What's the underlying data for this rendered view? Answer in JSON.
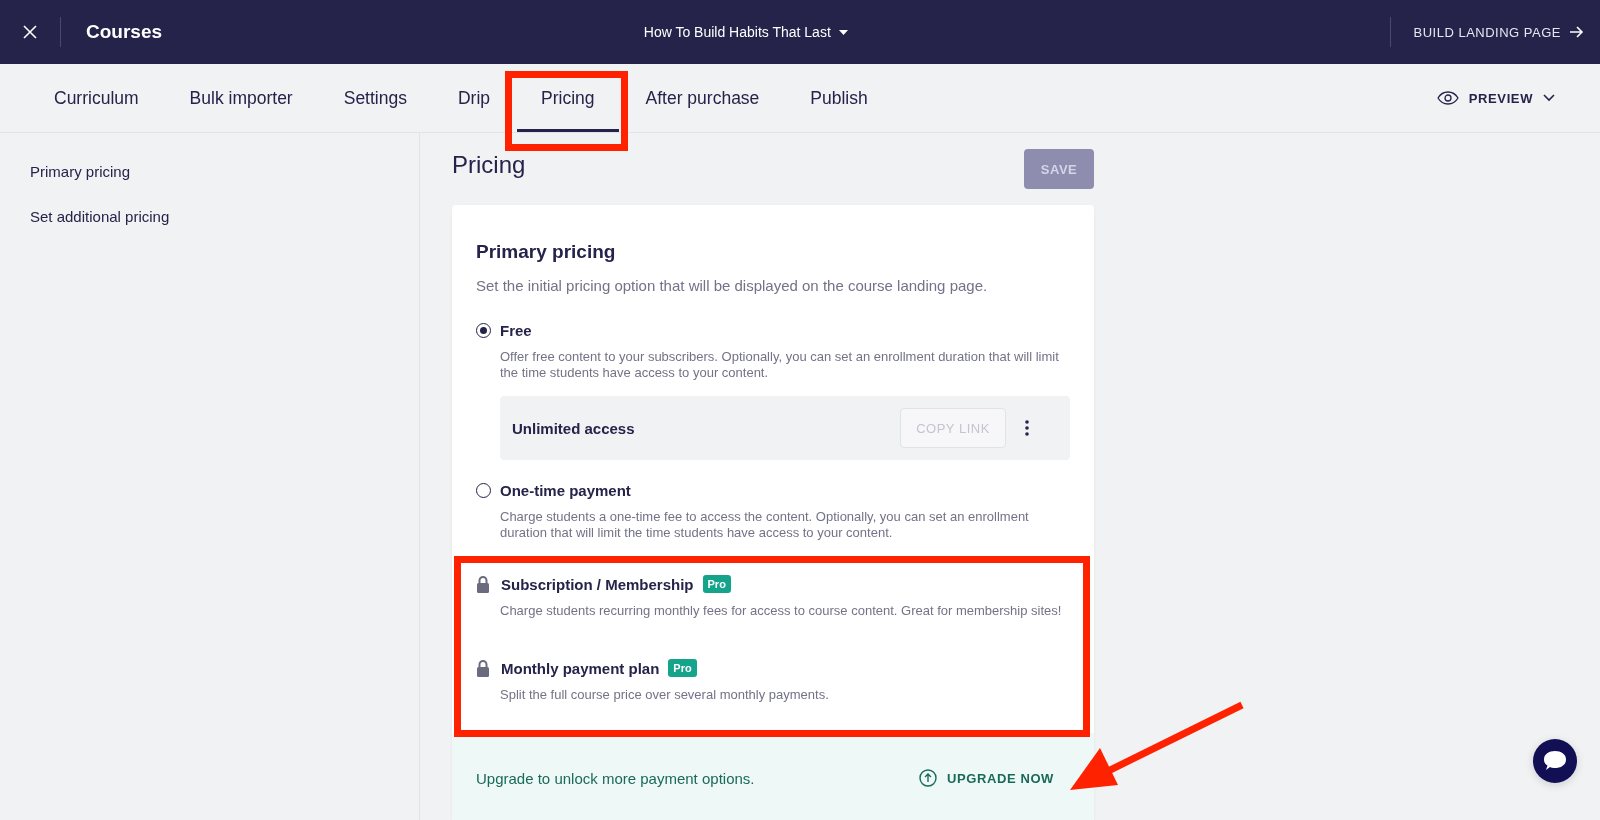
{
  "top_bar": {
    "title": "Courses",
    "course_selector": "How To Build Habits That Last",
    "action": "BUILD LANDING PAGE"
  },
  "tabs": [
    {
      "label": "Curriculum",
      "selected": false
    },
    {
      "label": "Bulk importer",
      "selected": false
    },
    {
      "label": "Settings",
      "selected": false
    },
    {
      "label": "Drip",
      "selected": false
    },
    {
      "label": "Pricing",
      "selected": true
    },
    {
      "label": "After purchase",
      "selected": false
    },
    {
      "label": "Publish",
      "selected": false
    }
  ],
  "preview": "PREVIEW",
  "sidebar": {
    "items": [
      {
        "label": "Primary pricing"
      },
      {
        "label": "Set additional pricing"
      }
    ]
  },
  "page": {
    "title": "Pricing",
    "save_button": {
      "label": "SAVE",
      "disabled": true
    }
  },
  "card": {
    "heading": "Primary pricing",
    "description": "Set the initial pricing option that will be displayed on the course landing page.",
    "options": [
      {
        "kind": "radio",
        "label": "Free",
        "selected": true,
        "description": "Offer free content to your subscribers. Optionally, you can set an enrollment duration that will limit the time students have access to your content.",
        "access": {
          "label": "Unlimited access",
          "button": "COPY LINK",
          "disabled": true
        }
      },
      {
        "kind": "radio",
        "label": "One-time payment",
        "selected": false,
        "description": "Charge students a one-time fee to access the content. Optionally, you can set an enrollment duration that will limit the time students have access to your content."
      },
      {
        "kind": "locked",
        "label": "Subscription / Membership",
        "badge": "Pro",
        "description": "Charge students recurring monthly fees for access to course content. Great for membership sites!"
      },
      {
        "kind": "locked",
        "label": "Monthly payment plan",
        "badge": "Pro",
        "description": "Split the full course price over several monthly payments."
      }
    ],
    "upgrade": {
      "text": "Upgrade to unlock more payment options.",
      "button": "UPGRADE NOW"
    }
  }
}
